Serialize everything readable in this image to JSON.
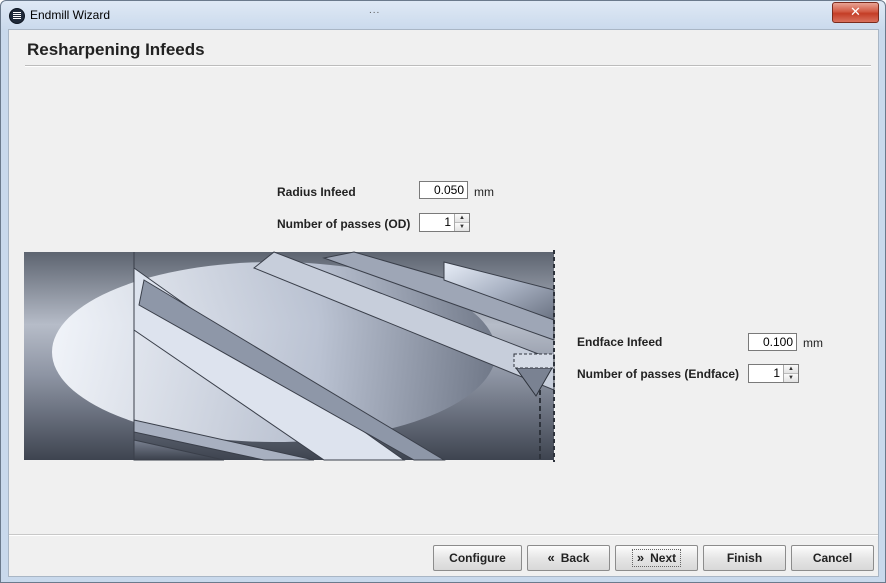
{
  "window": {
    "title": "Endmill Wizard",
    "title_dots": "...",
    "close_glyph": "✕"
  },
  "page": {
    "title": "Resharpening Infeeds"
  },
  "od": {
    "radius_label": "Radius Infeed",
    "radius_value": "0.050",
    "radius_unit": "mm",
    "passes_label": "Number of passes (OD)",
    "passes_value": "1"
  },
  "endface": {
    "infeed_label": "Endface Infeed",
    "infeed_value": "0.100",
    "infeed_unit": "mm",
    "passes_label": "Number of passes (Endface)",
    "passes_value": "1"
  },
  "buttons": {
    "configure": "Configure",
    "back": "Back",
    "back_icon": "«",
    "next": "Next",
    "next_icon": "»",
    "finish": "Finish",
    "cancel": "Cancel"
  },
  "icons": {
    "app": "endmill-wizard-app-icon",
    "close": "close-icon",
    "back": "chevron-left-double-icon",
    "next": "chevron-right-double-icon"
  }
}
